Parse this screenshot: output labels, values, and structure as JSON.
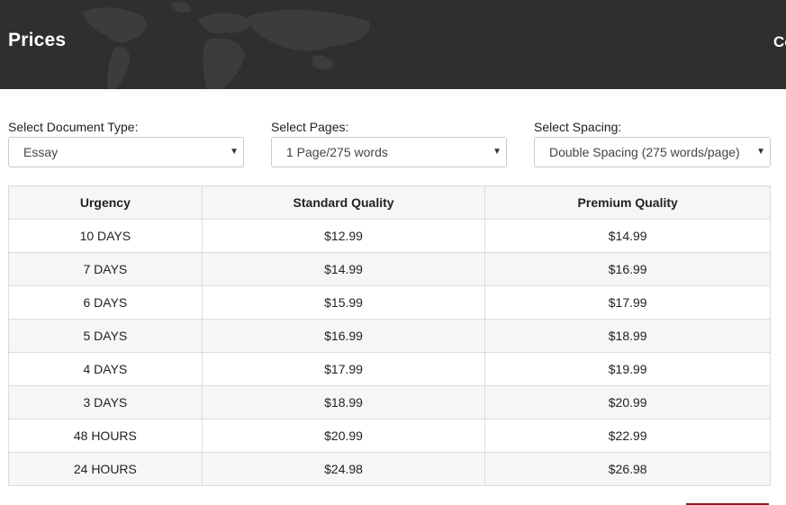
{
  "header": {
    "title": "Prices",
    "cut_text": "Co"
  },
  "selectors": {
    "document_type": {
      "label": "Select Document Type:",
      "value": "Essay"
    },
    "pages": {
      "label": "Select Pages:",
      "value": "1 Page/275 words"
    },
    "spacing": {
      "label": "Select Spacing:",
      "value": "Double Spacing (275 words/page)"
    }
  },
  "table": {
    "headers": [
      "Urgency",
      "Standard Quality",
      "Premium Quality"
    ],
    "rows": [
      [
        "10 DAYS",
        "$12.99",
        "$14.99"
      ],
      [
        "7 DAYS",
        "$14.99",
        "$16.99"
      ],
      [
        "6 DAYS",
        "$15.99",
        "$17.99"
      ],
      [
        "5 DAYS",
        "$16.99",
        "$18.99"
      ],
      [
        "4 DAYS",
        "$17.99",
        "$19.99"
      ],
      [
        "3 DAYS",
        "$18.99",
        "$20.99"
      ],
      [
        "48 HOURS",
        "$20.99",
        "$22.99"
      ],
      [
        "24 HOURS",
        "$24.98",
        "$26.98"
      ]
    ]
  },
  "colors": {
    "header_bg": "#2f2f2f",
    "accent": "#8b1c24"
  }
}
